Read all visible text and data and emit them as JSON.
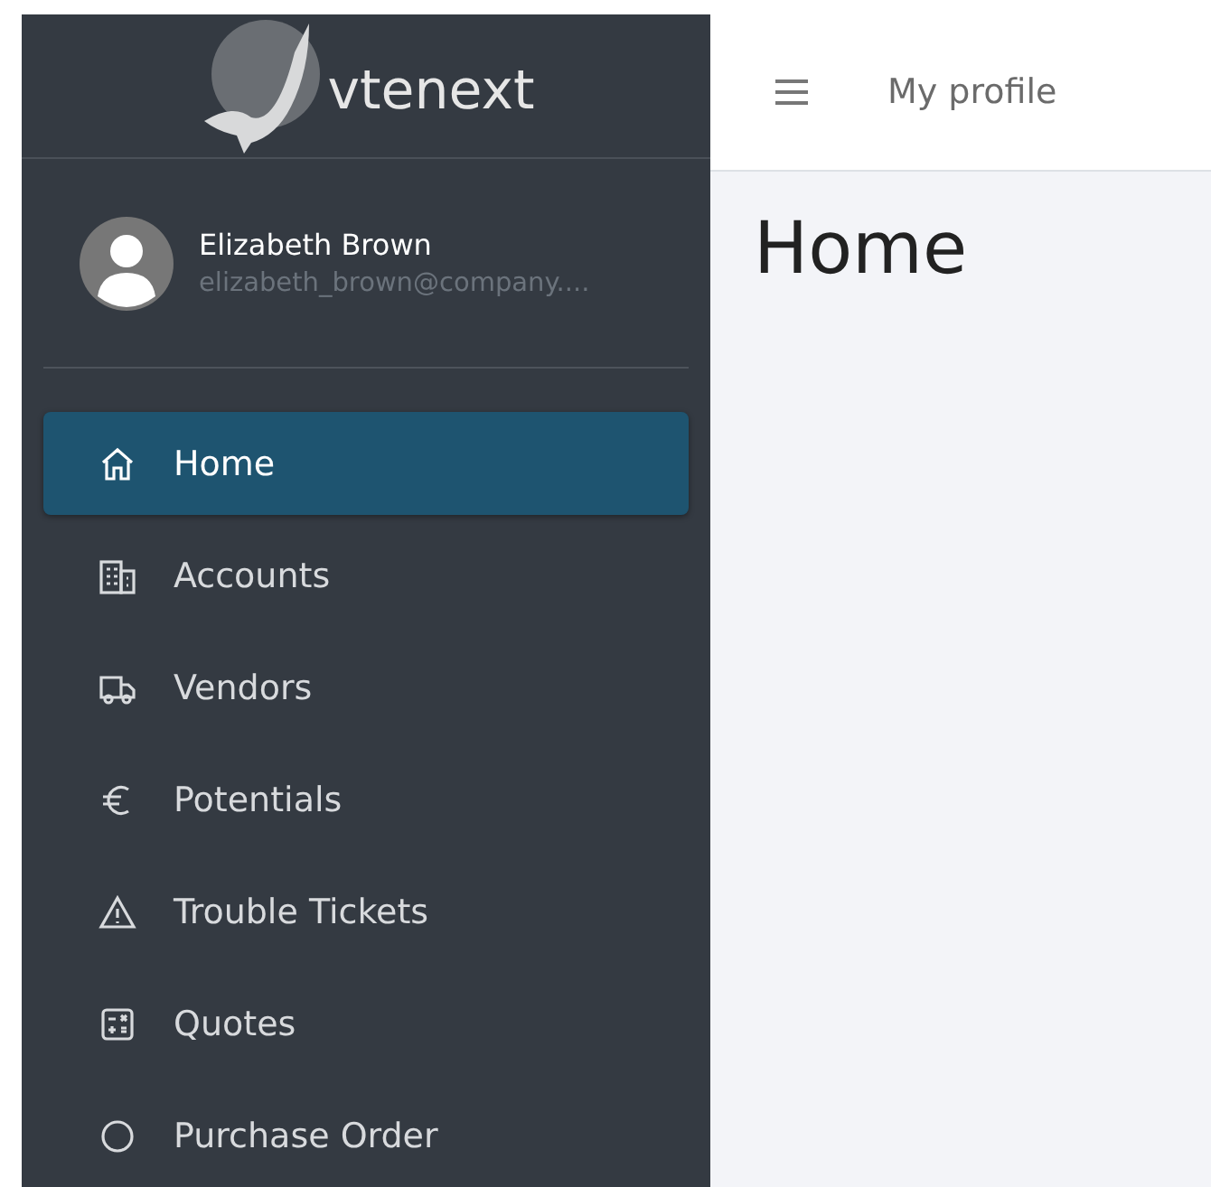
{
  "logo": {
    "text": "vtenext"
  },
  "user": {
    "name": "Elizabeth Brown",
    "email": "elizabeth_brown@company...."
  },
  "nav": [
    {
      "label": "Home",
      "selected": true
    },
    {
      "label": "Accounts",
      "selected": false
    },
    {
      "label": "Vendors",
      "selected": false
    },
    {
      "label": "Potentials",
      "selected": false
    },
    {
      "label": "Trouble Tickets",
      "selected": false
    },
    {
      "label": "Quotes",
      "selected": false
    },
    {
      "label": "Purchase Order",
      "selected": false
    }
  ],
  "header": {
    "link": "My profile"
  },
  "page": {
    "title": "Home"
  }
}
